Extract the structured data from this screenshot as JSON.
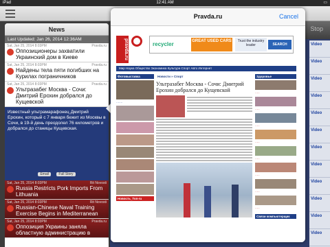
{
  "status": {
    "left": "iPad",
    "time": "12:41 AM",
    "battery": ""
  },
  "background_app": {
    "stop_label": "Stop",
    "video_items": [
      "Video",
      "Video",
      "Video",
      "Video",
      "Video",
      "Video",
      "Video",
      "Video",
      "Video",
      "Video",
      "Video",
      "Video"
    ]
  },
  "news": {
    "header": "News",
    "last_updated": "Last Updated: Jan 26, 2014 12:36AM",
    "items": [
      {
        "date": "Sat, Jan 25, 2014 8:03PM",
        "source": "Pravda.ru",
        "title": "Оппозиционеры захватили Украинский дом в Киеве"
      },
      {
        "date": "Sat, Jan 25, 2014 8:03PM",
        "source": "Pravda.ru",
        "title": "Найдены тела пяти погибших на Курилах пограничников"
      },
      {
        "date": "Sat, Jan 25, 2014 8:03PM",
        "source": "Pravda.ru",
        "title": "Ультразабег Москва - Сочи: Дмитрий Ерохин добрался до Кущевской"
      }
    ],
    "expanded_text": "Известный ультрамарафонец Дмитрий Ерохин, который с 7 января бежит из Москвы в Сочи, в 19-й день преодолел 76 километров и добрался до станицы Кущевская.",
    "email_label": "Email",
    "fullstory_label": "Full Story",
    "red_items": [
      {
        "date": "Sat, Jan 25, 2014 8:03PM",
        "source": "Rit Novosti",
        "title": "Russia Restricts Pork Imports From Lithuania"
      },
      {
        "date": "Sat, Jan 25, 2014 8:03PM",
        "source": "Rit Novosti",
        "title": "Russian-Chinese Naval Training Exercise Begins in Mediterranean"
      },
      {
        "date": "Sat, Jan 25, 2014 8:03PM",
        "source": "Pravda.ru",
        "title": "Оппозиция Украины заняла областную администрацию в"
      }
    ]
  },
  "popover": {
    "title": "Pravda.ru",
    "cancel_label": "Cancel",
    "site": {
      "logo_text": "pravda.ru",
      "ad_recycler": "recycler",
      "ad_cars": "GREAT USED CARS",
      "ad_trust": "Trust the industry leader",
      "ad_search": "SEARCH",
      "nav": "Мир  Наука  Общество  Экономика  Культура  Спорт  Авто  Интернет",
      "left_section": "Фотовыставка",
      "mid_section": "Новости » Спорт",
      "article_title": "Ультразабег Москва - Сочи: Дмитрий Ерохин добрался до Кущевской",
      "right_section": "Здоровье",
      "bottom_left_section": "Новость_Топ-ru",
      "bottom_right_section": "Связи компьютерщик"
    }
  }
}
